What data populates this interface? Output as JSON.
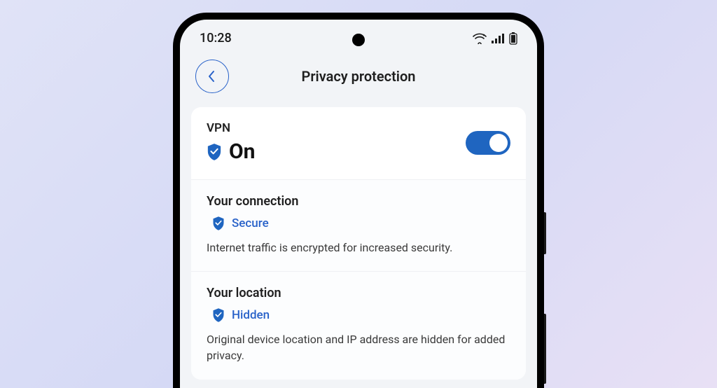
{
  "statusbar": {
    "time": "10:28"
  },
  "header": {
    "title": "Privacy protection"
  },
  "vpn": {
    "label": "VPN",
    "status": "On",
    "toggle_state": "on"
  },
  "connection": {
    "title": "Your connection",
    "status": "Secure",
    "description": "Internet traffic is encrypted for increased security."
  },
  "location": {
    "title": "Your location",
    "status": "Hidden",
    "description": "Original device location and IP address are hidden for added privacy."
  },
  "colors": {
    "accent": "#2962c9",
    "shield_fill": "#1f65c0"
  }
}
